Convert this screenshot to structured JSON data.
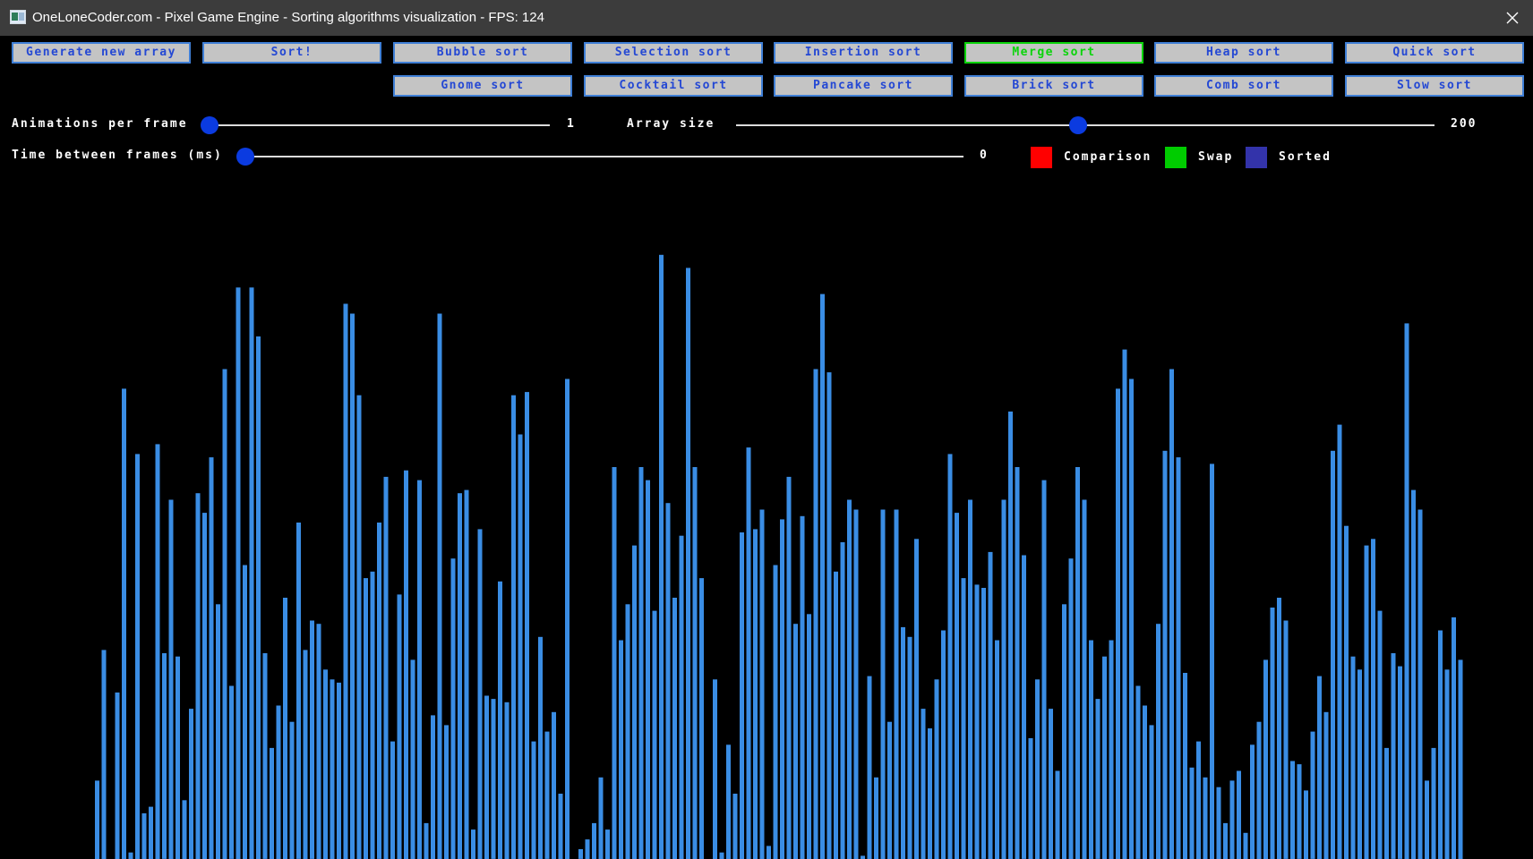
{
  "window": {
    "title": "OneLoneCoder.com - Pixel Game Engine - Sorting algorithms visualization - FPS: 124"
  },
  "toolbar": {
    "buttons": [
      {
        "label": "Generate new array"
      },
      {
        "label": "Sort!"
      },
      {
        "label": "Bubble sort"
      },
      {
        "label": "Selection sort"
      },
      {
        "label": "Insertion sort"
      },
      {
        "label": "Merge sort",
        "selected": true
      },
      {
        "label": "Heap sort"
      },
      {
        "label": "Quick sort"
      },
      {
        "label": "Gnome sort"
      },
      {
        "label": "Cocktail sort"
      },
      {
        "label": "Pancake sort"
      },
      {
        "label": "Brick sort"
      },
      {
        "label": "Comb sort"
      },
      {
        "label": "Slow sort"
      }
    ]
  },
  "sliders": {
    "animations": {
      "label": "Animations per frame",
      "value": "1"
    },
    "array_size": {
      "label": "Array size",
      "value": "200",
      "position_fraction": 0.49
    },
    "time_between": {
      "label": "Time between frames (ms)",
      "value": "0"
    }
  },
  "legend": {
    "items": [
      {
        "label": "Comparison",
        "color": "#ff0000"
      },
      {
        "label": "Swap",
        "color": "#00cc00"
      },
      {
        "label": "Sorted",
        "color": "#3333aa"
      }
    ]
  },
  "colors": {
    "bar": "#3a8de4",
    "button_bg": "#c4c4c4",
    "button_text": "#2448d4",
    "button_active": "#0bd40b",
    "slider_knob": "#0b3be0"
  },
  "chart_data": {
    "type": "bar",
    "value_max": 200,
    "values": [
      24,
      64,
      0,
      51,
      144,
      2,
      124,
      14,
      16,
      127,
      63,
      110,
      62,
      18,
      46,
      112,
      106,
      123,
      78,
      150,
      53,
      175,
      90,
      175,
      160,
      63,
      34,
      47,
      80,
      42,
      103,
      64,
      73,
      72,
      58,
      55,
      54,
      170,
      167,
      142,
      86,
      88,
      103,
      117,
      36,
      81,
      119,
      61,
      116,
      11,
      44,
      167,
      41,
      92,
      112,
      113,
      9,
      101,
      50,
      49,
      85,
      48,
      142,
      130,
      143,
      36,
      68,
      39,
      45,
      20,
      147,
      0,
      3,
      6,
      11,
      25,
      9,
      120,
      67,
      78,
      96,
      120,
      116,
      76,
      185,
      109,
      80,
      99,
      181,
      120,
      86,
      0,
      55,
      2,
      35,
      20,
      100,
      126,
      101,
      107,
      4,
      90,
      104,
      117,
      72,
      105,
      75,
      150,
      173,
      149,
      88,
      97,
      110,
      107,
      1,
      56,
      25,
      107,
      42,
      107,
      71,
      68,
      98,
      46,
      40,
      55,
      70,
      124,
      106,
      86,
      110,
      84,
      83,
      94,
      67,
      110,
      137,
      120,
      93,
      37,
      55,
      116,
      46,
      27,
      78,
      92,
      120,
      110,
      67,
      49,
      62,
      67,
      144,
      156,
      147,
      53,
      47,
      41,
      72,
      125,
      150,
      123,
      57,
      28,
      36,
      25,
      121,
      22,
      11,
      24,
      27,
      8,
      35,
      42,
      61,
      77,
      80,
      73,
      30,
      29,
      21,
      39,
      56,
      45,
      125,
      133,
      102,
      62,
      58,
      96,
      98,
      76,
      34,
      63,
      59,
      164,
      113,
      107,
      24,
      34,
      70,
      58,
      74,
      61
    ]
  }
}
